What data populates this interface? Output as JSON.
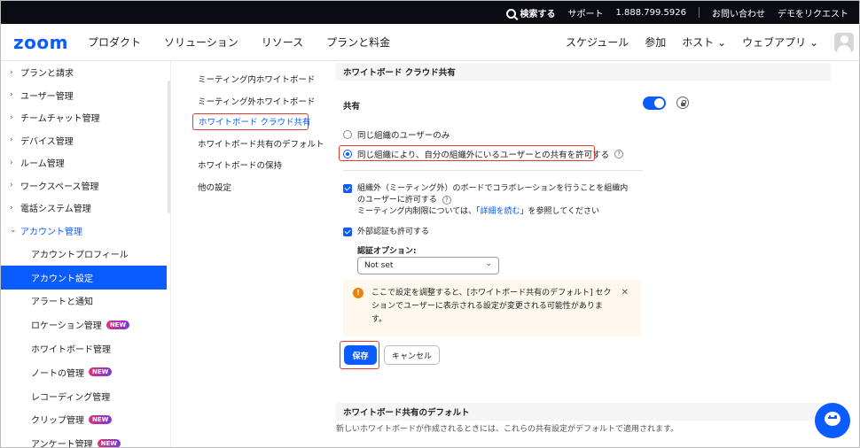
{
  "topbar": {
    "search": "検索する",
    "support": "サポート",
    "phone": "1.888.799.5926",
    "contact": "お問い合わせ",
    "demo": "デモをリクエスト"
  },
  "nav": {
    "logo": "zoom",
    "items": [
      "プロダクト",
      "ソリューション",
      "リソース",
      "プランと料金"
    ],
    "right": [
      "スケジュール",
      "参加",
      "ホスト",
      "ウェブアプリ"
    ]
  },
  "sidebar": {
    "items": [
      "プランと請求",
      "ユーザー管理",
      "チームチャット管理",
      "デバイス管理",
      "ルーム管理",
      "ワークスペース管理",
      "電話システム管理",
      "アカウント管理"
    ],
    "sub": [
      {
        "label": "アカウントプロフィール"
      },
      {
        "label": "アカウント設定",
        "active": true
      },
      {
        "label": "アラートと通知"
      },
      {
        "label": "ロケーション管理",
        "badge": "NEW"
      },
      {
        "label": "ホワイトボード管理"
      },
      {
        "label": "ノートの管理",
        "badge": "NEW"
      },
      {
        "label": "レコーディング管理"
      },
      {
        "label": "クリップ管理",
        "badge": "NEW"
      },
      {
        "label": "アンケート管理",
        "badge": "NEW"
      }
    ]
  },
  "subnav": [
    "ミーティング内ホワイトボード",
    "ミーティング外ホワイトボード",
    "ホワイトボード クラウド共有",
    "ホワイトボード共有のデフォルト",
    "ホワイトボードの保持",
    "他の設定"
  ],
  "main": {
    "section_title": "ホワイトボード クラウド共有",
    "share_label": "共有",
    "toggle_on": true,
    "radio1": "同じ組織のユーザーのみ",
    "radio2": "同じ組織により、自分の組織外にいるユーザーとの共有を許可する",
    "check1_line1": "組織外（ミーティング外）のボードでコラボレーションを行うことを組織内",
    "check1_line2": "のユーザーに許可する",
    "check1_note_pre": "ミーティング内制限については、「",
    "check1_note_link": "詳細を読む",
    "check1_note_post": "」を参照してください",
    "check2": "外部認証も許可する",
    "auth_label": "認証オプション:",
    "auth_value": "Not set",
    "alert_text": "ここで設定を調整すると、[ホワイトボード共有のデフォルト] セクションでユーザーに表示される設定が変更される可能性があります。",
    "save": "保存",
    "cancel": "キャンセル",
    "section2_title": "ホワイトボード共有のデフォルト",
    "section2_desc": "新しいホワイトボードが作成されるときには、これらの共有設定がデフォルトで適用されます。"
  },
  "colors": {
    "accent": "#0b5cff",
    "highlight": "#e53935"
  }
}
